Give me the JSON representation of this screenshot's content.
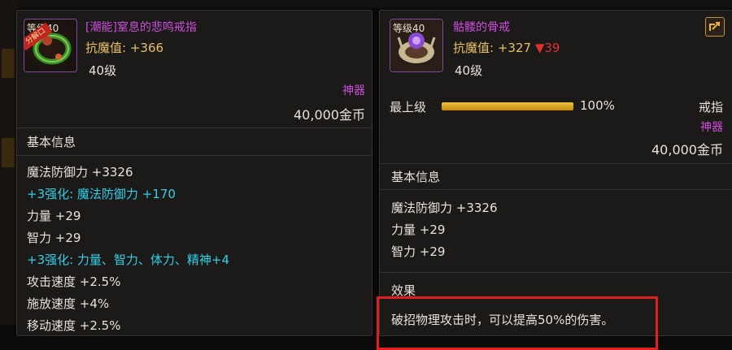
{
  "left_item": {
    "level_tag": "等级40",
    "ribbon": "分解口",
    "name": "[潮能]窒息的悲鸣戒指",
    "stat_label": "抗魔值:",
    "stat_value": "+366",
    "level": "40级",
    "rarity": "神器",
    "price": "40,000金币",
    "basic_info_title": "基本信息",
    "attributes": [
      {
        "text": "魔法防御力 +3326",
        "style": "normal"
      },
      {
        "text": "+3强化: 魔法防御力 +170",
        "style": "cyan"
      },
      {
        "text": "力量 +29",
        "style": "normal"
      },
      {
        "text": "智力 +29",
        "style": "normal"
      },
      {
        "text": "+3强化: 力量、智力、体力、精神+4",
        "style": "cyan"
      },
      {
        "text": "攻击速度 +2.5%",
        "style": "normal"
      },
      {
        "text": "施放速度 +4%",
        "style": "normal"
      },
      {
        "text": "移动速度 +2.5%",
        "style": "normal"
      }
    ]
  },
  "right_item": {
    "level_tag": "等级40",
    "name": "骷髅的骨戒",
    "stat_label": "抗魔值:",
    "stat_value": "+327",
    "stat_down": "▼39",
    "level": "40级",
    "grade_label": "最上级",
    "grade_percent": "100%",
    "grade_fraction": 1.0,
    "type": "戒指",
    "rarity": "神器",
    "price": "40,000金币",
    "basic_info_title": "基本信息",
    "attributes": [
      {
        "text": "魔法防御力 +3326"
      },
      {
        "text": "力量 +29"
      },
      {
        "text": "智力 +29"
      }
    ],
    "effect_title": "效果",
    "effect_text": "破招物理攻击时，可以提高50%的伤害。"
  },
  "colors": {
    "rarity_purple": "#d04ce0",
    "stat_gold": "#e6c066",
    "enhance_cyan": "#2fd0e8",
    "down_red": "#e03030",
    "highlight_red": "#e02020"
  },
  "icons": {
    "left_item_icon": "green-ring-icon",
    "right_item_icon": "bone-ring-icon",
    "share": "share-icon"
  }
}
